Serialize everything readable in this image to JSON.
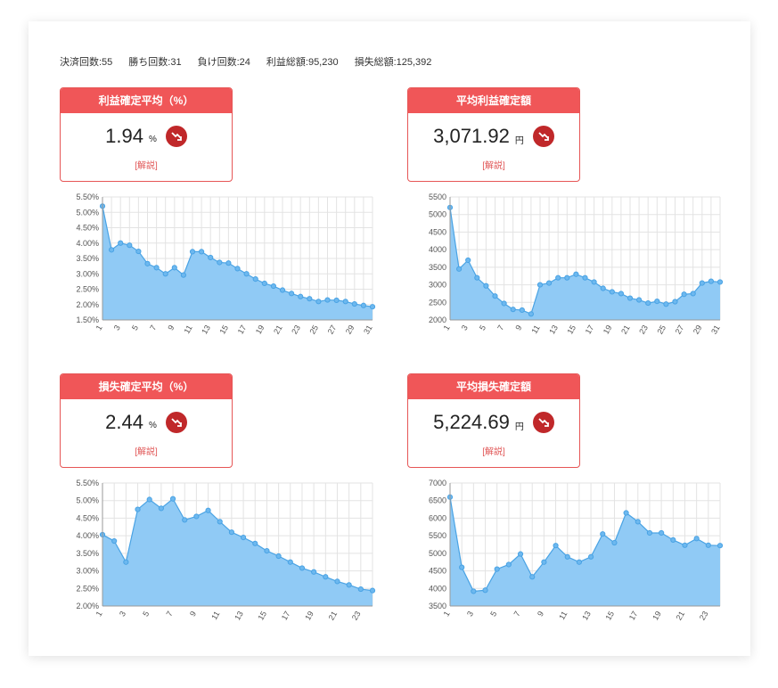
{
  "stats": {
    "settled": "決済回数:55",
    "wins": "勝ち回数:31",
    "losses": "負け回数:24",
    "profit_total": "利益総額:95,230",
    "loss_total": "損失総額:125,392"
  },
  "kpis": [
    {
      "title": "利益確定平均（%）",
      "value": "1.94",
      "unit": "%",
      "link": "[解説]",
      "icon": "trend-down-icon"
    },
    {
      "title": "平均利益確定額",
      "value": "3,071.92",
      "unit": "円",
      "link": "[解説]",
      "icon": "trend-down-icon"
    },
    {
      "title": "損失確定平均（%）",
      "value": "2.44",
      "unit": "%",
      "link": "[解説]",
      "icon": "trend-down-icon"
    },
    {
      "title": "平均損失確定額",
      "value": "5,224.69",
      "unit": "円",
      "link": "[解説]",
      "icon": "trend-down-icon"
    }
  ],
  "colors": {
    "accent": "#f05658",
    "fill": "#90caf5",
    "line": "#4aa3e4",
    "grid": "#e3e3e3"
  },
  "chart_data": [
    {
      "type": "area",
      "x": [
        1,
        2,
        3,
        4,
        5,
        6,
        7,
        8,
        9,
        10,
        11,
        12,
        13,
        14,
        15,
        16,
        17,
        18,
        19,
        20,
        21,
        22,
        23,
        24,
        25,
        26,
        27,
        28,
        29,
        30,
        31
      ],
      "values": [
        5.2,
        3.78,
        4.0,
        3.93,
        3.73,
        3.33,
        3.2,
        3.0,
        3.2,
        2.96,
        3.72,
        3.72,
        3.53,
        3.37,
        3.35,
        3.17,
        3.0,
        2.83,
        2.69,
        2.6,
        2.47,
        2.36,
        2.26,
        2.19,
        2.1,
        2.15,
        2.14,
        2.1,
        2.02,
        1.97,
        1.93
      ],
      "ylim": [
        1.5,
        5.5
      ],
      "yticks": [
        "1.50%",
        "2.00%",
        "2.50%",
        "3.00%",
        "3.50%",
        "4.00%",
        "4.50%",
        "5.00%",
        "5.50%"
      ],
      "xticks": [
        "1",
        "3",
        "5",
        "7",
        "9",
        "11",
        "13",
        "15",
        "17",
        "19",
        "21",
        "23",
        "25",
        "27",
        "29",
        "31"
      ]
    },
    {
      "type": "area",
      "x": [
        1,
        2,
        3,
        4,
        5,
        6,
        7,
        8,
        9,
        10,
        11,
        12,
        13,
        14,
        15,
        16,
        17,
        18,
        19,
        20,
        21,
        22,
        23,
        24,
        25,
        26,
        27,
        28,
        29,
        30,
        31
      ],
      "values": [
        5200,
        3450,
        3700,
        3200,
        2970,
        2680,
        2470,
        2300,
        2280,
        2170,
        3000,
        3050,
        3200,
        3200,
        3300,
        3200,
        3080,
        2900,
        2800,
        2750,
        2620,
        2570,
        2480,
        2530,
        2450,
        2520,
        2730,
        2750,
        3050,
        3100,
        3080
      ],
      "ylim": [
        2000,
        5500
      ],
      "yticks": [
        "2000",
        "2500",
        "3000",
        "3500",
        "4000",
        "4500",
        "5000",
        "5500"
      ],
      "xticks": [
        "1",
        "3",
        "5",
        "7",
        "9",
        "11",
        "13",
        "15",
        "17",
        "19",
        "21",
        "23",
        "25",
        "27",
        "29",
        "31"
      ]
    },
    {
      "type": "area",
      "x": [
        1,
        2,
        3,
        4,
        5,
        6,
        7,
        8,
        9,
        10,
        11,
        12,
        13,
        14,
        15,
        16,
        17,
        18,
        19,
        20,
        21,
        22,
        23,
        24
      ],
      "values": [
        4.03,
        3.85,
        3.25,
        4.75,
        5.03,
        4.78,
        5.05,
        4.45,
        4.55,
        4.72,
        4.4,
        4.1,
        3.95,
        3.78,
        3.57,
        3.42,
        3.25,
        3.08,
        2.97,
        2.83,
        2.7,
        2.6,
        2.48,
        2.44
      ],
      "ylim": [
        2.0,
        5.5
      ],
      "yticks": [
        "2.00%",
        "2.50%",
        "3.00%",
        "3.50%",
        "4.00%",
        "4.50%",
        "5.00%",
        "5.50%"
      ],
      "xticks": [
        "1",
        "3",
        "5",
        "7",
        "9",
        "11",
        "13",
        "15",
        "17",
        "19",
        "21",
        "23"
      ]
    },
    {
      "type": "area",
      "x": [
        1,
        2,
        3,
        4,
        5,
        6,
        7,
        8,
        9,
        10,
        11,
        12,
        13,
        14,
        15,
        16,
        17,
        18,
        19,
        20,
        21,
        22,
        23,
        24
      ],
      "values": [
        6600,
        4600,
        3920,
        3950,
        4550,
        4680,
        4980,
        4330,
        4750,
        5220,
        4900,
        4750,
        4900,
        5550,
        5300,
        6150,
        5900,
        5580,
        5580,
        5380,
        5230,
        5420,
        5230,
        5220
      ],
      "ylim": [
        3500,
        7000
      ],
      "yticks": [
        "3500",
        "4000",
        "4500",
        "5000",
        "5500",
        "6000",
        "6500",
        "7000"
      ],
      "xticks": [
        "1",
        "3",
        "5",
        "7",
        "9",
        "11",
        "13",
        "15",
        "17",
        "19",
        "21",
        "23"
      ]
    }
  ]
}
